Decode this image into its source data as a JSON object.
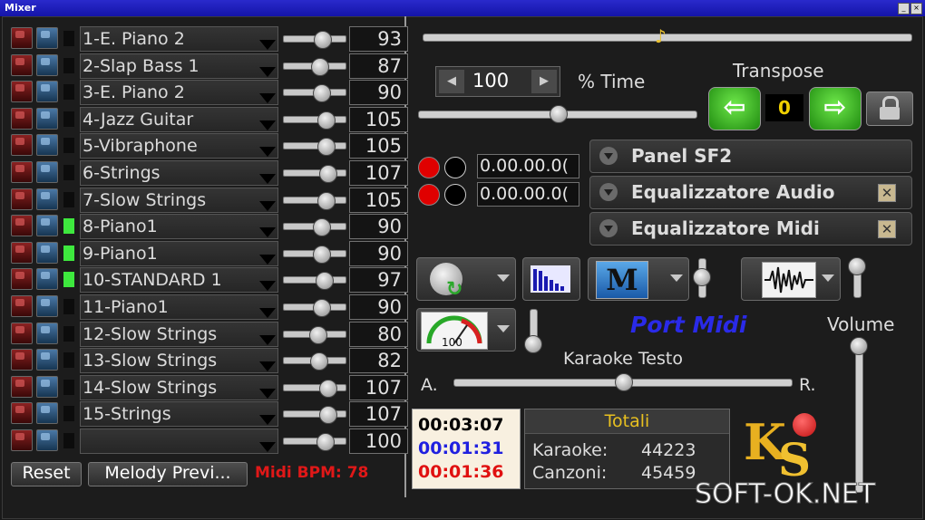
{
  "window": {
    "title": "Mixer"
  },
  "channels": [
    {
      "name": "1-E. Piano 2",
      "volume": "93",
      "fader": 0.62,
      "active": false
    },
    {
      "name": "2-Slap Bass 1",
      "volume": "87",
      "fader": 0.58,
      "active": false
    },
    {
      "name": "3-E. Piano 2",
      "volume": "90",
      "fader": 0.6,
      "active": false
    },
    {
      "name": "4-Jazz Guitar",
      "volume": "105",
      "fader": 0.68,
      "active": false
    },
    {
      "name": "5-Vibraphone",
      "volume": "105",
      "fader": 0.68,
      "active": false
    },
    {
      "name": "6-Strings",
      "volume": "107",
      "fader": 0.7,
      "active": false
    },
    {
      "name": "7-Slow Strings",
      "volume": "105",
      "fader": 0.68,
      "active": false
    },
    {
      "name": "8-Piano1",
      "volume": "90",
      "fader": 0.6,
      "active": true
    },
    {
      "name": "9-Piano1",
      "volume": "90",
      "fader": 0.6,
      "active": true
    },
    {
      "name": "10-STANDARD 1",
      "volume": "97",
      "fader": 0.64,
      "active": true
    },
    {
      "name": "11-Piano1",
      "volume": "90",
      "fader": 0.6,
      "active": false
    },
    {
      "name": "12-Slow Strings",
      "volume": "80",
      "fader": 0.55,
      "active": false
    },
    {
      "name": "13-Slow Strings",
      "volume": "82",
      "fader": 0.56,
      "active": false
    },
    {
      "name": "14-Slow Strings",
      "volume": "107",
      "fader": 0.7,
      "active": false
    },
    {
      "name": "15-Strings",
      "volume": "107",
      "fader": 0.7,
      "active": false
    },
    {
      "name": "",
      "volume": "100",
      "fader": 0.66,
      "active": false
    }
  ],
  "footer": {
    "reset_label": "Reset",
    "melody_label": "Melody Previ...",
    "bpm_text": "Midi BPM: 78"
  },
  "tempo": {
    "value": "100",
    "label": "% Time",
    "level": 0.5
  },
  "position": {
    "level": 0.49
  },
  "transpose": {
    "label": "Transpose",
    "value": "0"
  },
  "markers": [
    "0.00.00.0(",
    "0.00.00.0("
  ],
  "panels": [
    {
      "label": "Panel SF2",
      "checkbox": false
    },
    {
      "label": "Equalizzatore Audio",
      "checkbox": true
    },
    {
      "label": "Equalizzatore Midi",
      "checkbox": true
    }
  ],
  "port_midi": "Port Midi",
  "karaoke": {
    "label": "Karaoke Testo",
    "left": "A.",
    "right": "R.",
    "level": 0.5
  },
  "volume": {
    "label": "Volume"
  },
  "times": [
    {
      "value": "00:03:07",
      "color": "#000000"
    },
    {
      "value": "00:01:31",
      "color": "#2020e0"
    },
    {
      "value": "00:01:36",
      "color": "#e01010"
    }
  ],
  "totals": {
    "title": "Totali",
    "karaoke_label": "Karaoke:",
    "karaoke_value": "44223",
    "songs_label": "Canzoni:",
    "songs_value": "45459"
  },
  "watermark": "SOFT-OK.NET",
  "colors": {
    "accent_green": "#3ee83e",
    "bpm_red": "#e01818",
    "port_midi_blue": "#2a2ae8",
    "totals_gold": "#e8c020"
  }
}
